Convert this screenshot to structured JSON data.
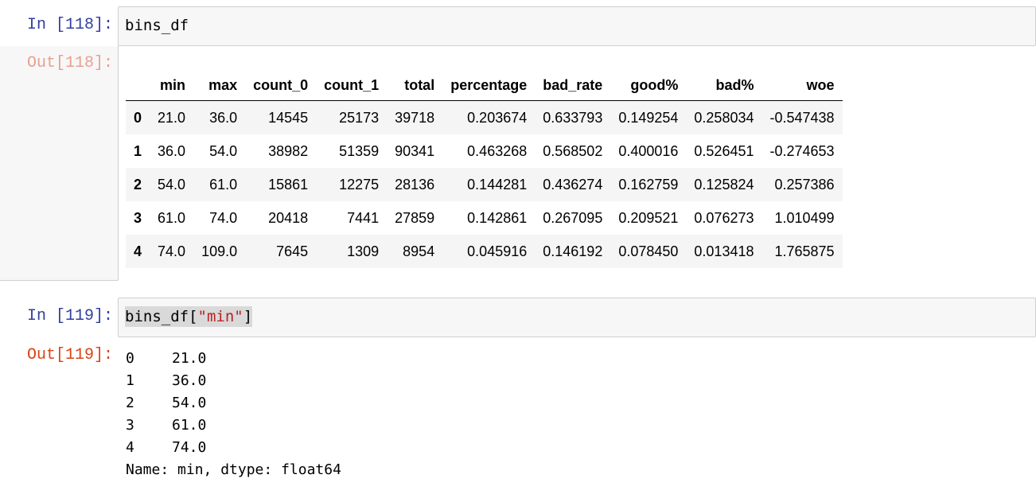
{
  "cells": [
    {
      "in_prompt": "In  [118]:",
      "code": "bins_df",
      "out_prompt": "Out[118]:",
      "table": {
        "columns": [
          "min",
          "max",
          "count_0",
          "count_1",
          "total",
          "percentage",
          "bad_rate",
          "good%",
          "bad%",
          "woe"
        ],
        "rows": [
          {
            "index": "0",
            "values": [
              "21.0",
              "36.0",
              "14545",
              "25173",
              "39718",
              "0.203674",
              "0.633793",
              "0.149254",
              "0.258034",
              "-0.547438"
            ]
          },
          {
            "index": "1",
            "values": [
              "36.0",
              "54.0",
              "38982",
              "51359",
              "90341",
              "0.463268",
              "0.568502",
              "0.400016",
              "0.526451",
              "-0.274653"
            ]
          },
          {
            "index": "2",
            "values": [
              "54.0",
              "61.0",
              "15861",
              "12275",
              "28136",
              "0.144281",
              "0.436274",
              "0.162759",
              "0.125824",
              "0.257386"
            ]
          },
          {
            "index": "3",
            "values": [
              "61.0",
              "74.0",
              "20418",
              "7441",
              "27859",
              "0.142861",
              "0.267095",
              "0.209521",
              "0.076273",
              "1.010499"
            ]
          },
          {
            "index": "4",
            "values": [
              "74.0",
              "109.0",
              "7645",
              "1309",
              "8954",
              "0.045916",
              "0.146192",
              "0.078450",
              "0.013418",
              "1.765875"
            ]
          }
        ]
      }
    },
    {
      "in_prompt": "In  [119]:",
      "code_prefix": "bins_df[",
      "code_string": "\"min\"",
      "code_suffix": "]",
      "out_prompt": "Out[119]:",
      "series": [
        {
          "index": "0",
          "value": "21.0"
        },
        {
          "index": "1",
          "value": "36.0"
        },
        {
          "index": "2",
          "value": "54.0"
        },
        {
          "index": "3",
          "value": "61.0"
        },
        {
          "index": "4",
          "value": "74.0"
        }
      ],
      "series_footer": "Name: min, dtype: float64"
    }
  ],
  "colors": {
    "in_prompt": "#303f9f",
    "out_prompt": "#d84315",
    "string": "#ba2121",
    "cell_bg": "#f7f7f7"
  }
}
